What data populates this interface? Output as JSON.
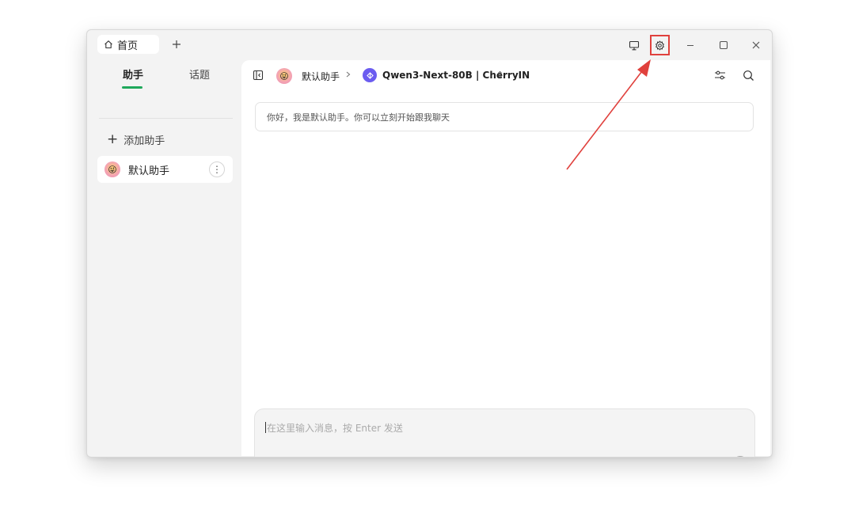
{
  "titlebar": {
    "home_tab_label": "首页",
    "icons": [
      "home-icon",
      "plus-icon",
      "monitor-icon",
      "gear-icon",
      "minimize-icon",
      "maximize-icon",
      "close-icon"
    ]
  },
  "sidebar": {
    "tabs": [
      {
        "label": "助手",
        "active": true
      },
      {
        "label": "话题",
        "active": false
      }
    ],
    "add_assistant_label": "添加助手",
    "assistants": [
      {
        "name": "默认助手",
        "avatar": "😜"
      }
    ],
    "more_glyph": "⋮"
  },
  "main": {
    "header": {
      "assistant_name": "默认助手",
      "model_label": "Qwen3-Next-80B | CherryIN",
      "model_switch_glyph": "⇕"
    },
    "greeting": "你好，我是默认助手。你可以立刻开始跟我聊天",
    "input": {
      "placeholder": "在这里输入消息，按 Enter 发送"
    },
    "toolbar_icons": [
      "new-topic-icon",
      "attachment-icon",
      "web-search-icon",
      "knowledge-base-icon",
      "mcp-tools-icon",
      "mention-icon",
      "expand-icon",
      "translate-icon",
      "send-icon"
    ]
  },
  "colors": {
    "accent": "#1fa85b",
    "highlight_red": "#e0413d",
    "model_icon": "#6b5cf0"
  }
}
